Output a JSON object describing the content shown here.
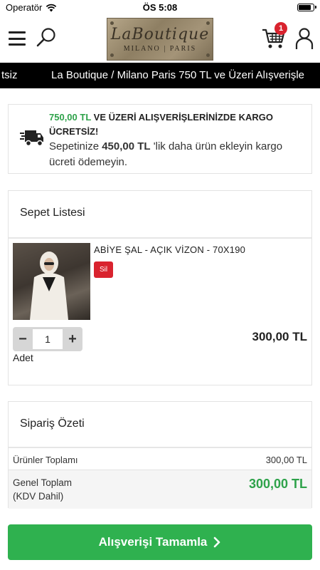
{
  "status_bar": {
    "carrier": "Operatör",
    "time": "ÖS 5:08",
    "battery_level": 0.9
  },
  "header": {
    "logo_script": "LaBoutique",
    "logo_sub": "MILANO | PARIS",
    "cart_count": "1",
    "icons": [
      "menu-icon",
      "search-icon",
      "cart-icon",
      "user-icon"
    ]
  },
  "marquee": {
    "left_fragment": "tsiz",
    "text": "La Boutique / Milano Paris 750 TL ve Üzeri Alışverişle"
  },
  "shipping_notice": {
    "threshold": "750,00 TL",
    "headline_rest": " VE ÜZERİ ALIŞVERİŞLERİNİZDE KARGO ÜCRETSİZ!",
    "remaining_prefix": "Sepetinize ",
    "remaining_amount": "450,00 TL",
    "remaining_suffix": " 'lik daha ürün ekleyin kargo ücreti ödemeyin."
  },
  "cart": {
    "title": "Sepet Listesi",
    "items": [
      {
        "name": "ABİYE ŞAL - AÇIK VİZON - 70X190",
        "delete_label": "Sil",
        "quantity": "1",
        "minus": "−",
        "plus": "+",
        "quantity_label": "Adet",
        "price": "300,00 TL"
      }
    ]
  },
  "summary": {
    "title": "Sipariş Özeti",
    "subtotal_label": "Ürünler Toplamı",
    "subtotal_value": "300,00 TL",
    "total_label": "Genel Toplam",
    "total_note": "(KDV Dahil)",
    "total_value": "300,00 TL"
  },
  "checkout": {
    "label": "Alışverişi Tamamla"
  },
  "colors": {
    "accent_green": "#2ea24a",
    "button_green": "#2fb14f",
    "badge_red": "#d9232e",
    "marquee_bg": "#000000"
  }
}
